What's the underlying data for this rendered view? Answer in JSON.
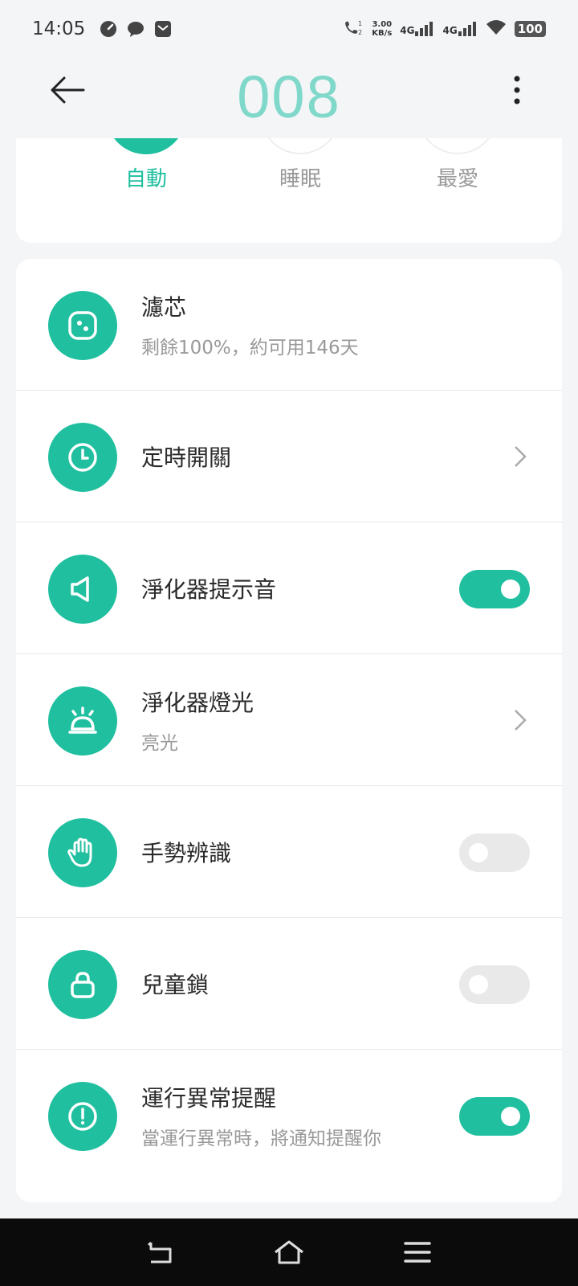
{
  "status": {
    "time": "14:05",
    "net_speed_value": "3.00",
    "net_speed_unit": "KB/s",
    "sim1_label": "4G",
    "sim2_label": "4G",
    "battery": "100"
  },
  "header": {
    "title": "008"
  },
  "modes": [
    {
      "label": "自動",
      "active": true
    },
    {
      "label": "睡眠",
      "active": false
    },
    {
      "label": "最愛",
      "active": false
    }
  ],
  "settings": {
    "filter": {
      "title": "濾芯",
      "subtitle": "剩餘100%，約可用146天",
      "icon": "filter-icon"
    },
    "timer": {
      "title": "定時開關",
      "icon": "clock-icon"
    },
    "sound": {
      "title": "淨化器提示音",
      "icon": "speaker-icon",
      "enabled": true
    },
    "light": {
      "title": "淨化器燈光",
      "subtitle": "亮光",
      "icon": "light-icon"
    },
    "gesture": {
      "title": "手勢辨識",
      "icon": "hand-icon",
      "enabled": false
    },
    "child_lock": {
      "title": "兒童鎖",
      "icon": "lock-icon",
      "enabled": false
    },
    "alert": {
      "title": "運行異常提醒",
      "subtitle": "當運行異常時，將通知提醒你",
      "icon": "alert-icon",
      "enabled": true
    }
  },
  "colors": {
    "accent": "#1fbf9f",
    "title": "#7fd8c9",
    "background": "#f3f5f7"
  }
}
